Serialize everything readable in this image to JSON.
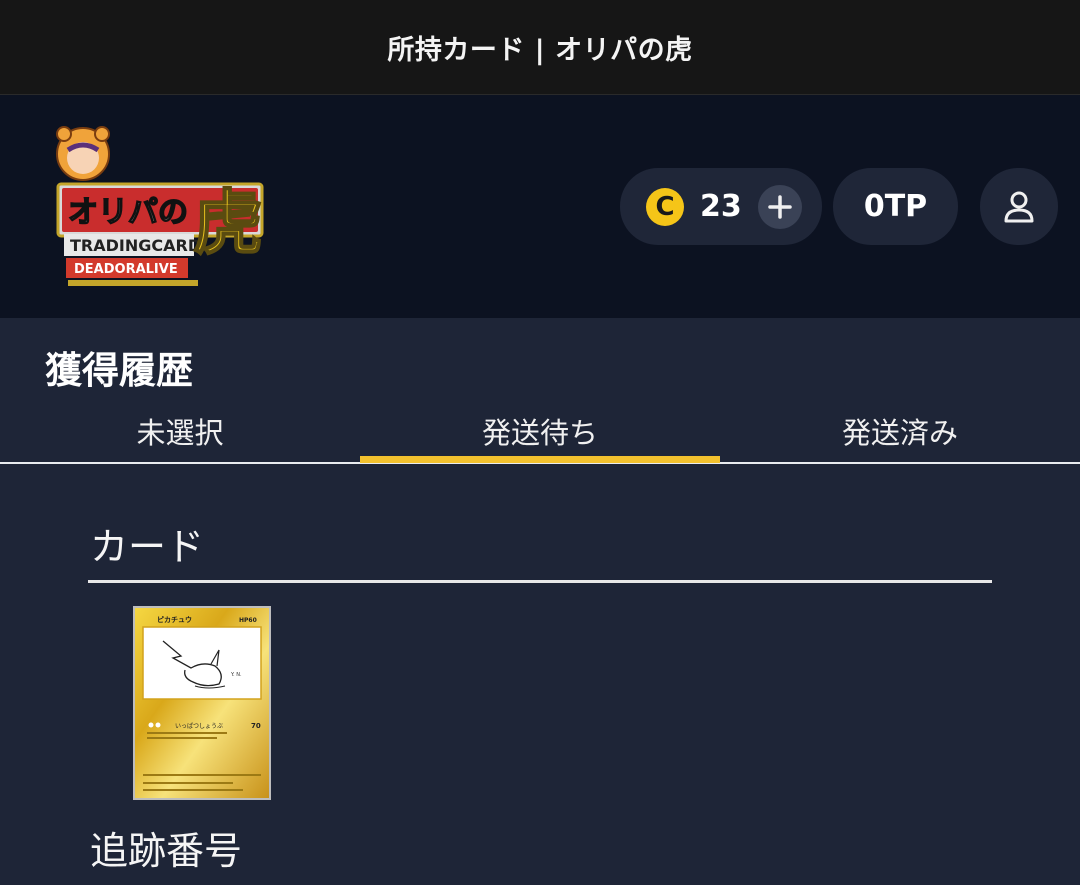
{
  "titlebar": {
    "title": "所持カード | オリパの虎"
  },
  "header": {
    "logo": {
      "text_main": "オリパの",
      "text_big": "虎",
      "text_sub": "TRADINGCARD",
      "text_brand": "DEADORALIVE"
    },
    "coin": {
      "symbol": "C",
      "count": "23"
    },
    "points": {
      "label": "0TP"
    }
  },
  "page": {
    "section_title": "獲得履歴",
    "tabs": [
      {
        "label": "未選択",
        "active": false
      },
      {
        "label": "発送待ち",
        "active": true
      },
      {
        "label": "発送済み",
        "active": false
      }
    ],
    "card_label": "カード",
    "tracking_label": "追跡番号"
  },
  "card": {
    "name": "ピカチュウ",
    "hp": "HP60",
    "attack_name": "いっぱつしょうぶ",
    "attack_damage": "70"
  },
  "colors": {
    "accent": "#f2c12e",
    "header_bg": "#0c1221",
    "page_bg": "#1e2537",
    "coin": "#f5c518"
  },
  "icons": [
    "coin-icon",
    "plus-icon",
    "user-icon"
  ]
}
